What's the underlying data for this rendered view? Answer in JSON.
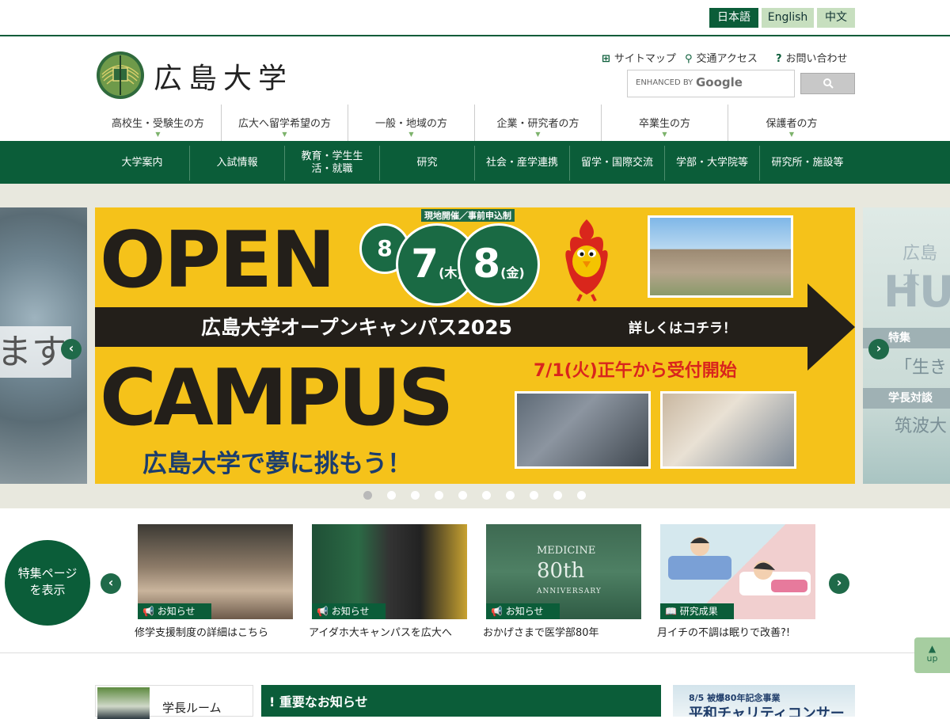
{
  "languages": {
    "ja": "日本語",
    "en": "English",
    "zh": "中文"
  },
  "header": {
    "site_name": "広島大学",
    "util_links": {
      "sitemap": "サイトマップ",
      "access": "交通アクセス",
      "contact": "お問い合わせ"
    },
    "search": {
      "placeholder": "ENHANCED BY",
      "google": "Google"
    }
  },
  "audience_nav": [
    "高校生・受験生の方",
    "広大へ留学希望の方",
    "一般・地域の方",
    "企業・研究者の方",
    "卒業生の方",
    "保護者の方"
  ],
  "main_nav": [
    "大学案内",
    "入試情報",
    "教育・学生生活・就職",
    "研究",
    "社会・産学連携",
    "留学・国際交流",
    "学部・大学院等",
    "研究所・施設等"
  ],
  "banner": {
    "open": "OPEN",
    "campus": "CAMPUS",
    "small_label": "現地開催／事前申込制",
    "date1": "8",
    "date2": "7",
    "weekday2": "(木)",
    "date3": "8",
    "weekday3": "(金)",
    "title": "広島大学オープンキャンパス2025",
    "detail": "詳しくはコチラ！",
    "reception": "7/1(火)正午から受付開始",
    "slogan": "広島大学で夢に挑もう！"
  },
  "side_left": {
    "text": "ます"
  },
  "side_right": {
    "big": "HU",
    "small": "広島大",
    "tag1": "特集",
    "txt1": "「生き",
    "tag2": "学長対談",
    "txt2": "筑波大"
  },
  "carousel": {
    "slide_count": 10,
    "active_index": 0
  },
  "features": {
    "circle_label": "特集ページを表示",
    "cards": [
      {
        "tag": "お知らせ",
        "caption": "修学支援制度の詳細はこちら"
      },
      {
        "tag": "お知らせ",
        "caption": "アイダホ大キャンパスを広大へ"
      },
      {
        "tag": "お知らせ",
        "caption": "おかげさまで医学部80年",
        "img_text_1": "MEDICINE",
        "img_text_2": "80th",
        "img_text_3": "ANNIVERSARY"
      },
      {
        "tag": "研究成果",
        "caption": "月イチの不調は眠りで改善?!"
      }
    ]
  },
  "up_button": "up",
  "bottom": {
    "president": "学長ルーム",
    "notice": "重要なお知らせ",
    "concert_1": "8/5 被爆80年記念事業",
    "concert_2": "平和チャリティコンサート"
  },
  "colors": {
    "brand_green": "#0b5d39",
    "light_green": "#c7dfbf",
    "banner_yellow": "#f5c21a"
  }
}
